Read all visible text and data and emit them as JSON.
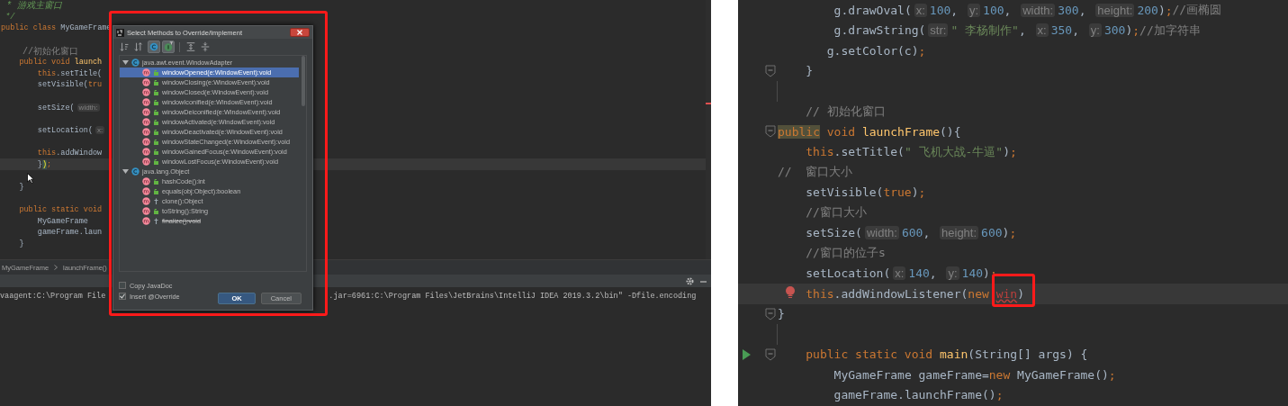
{
  "left_editor": {
    "lines": [
      {
        "tokens": [
          {
            "kind": "doc",
            "text": " * 游戏主窗口"
          }
        ]
      },
      {
        "tokens": [
          {
            "kind": "doc",
            "text": " */"
          }
        ]
      },
      {
        "tokens": [
          {
            "kind": "keyword",
            "text": "public class"
          },
          {
            "kind": "plain",
            "text": " MyGameFrame"
          }
        ]
      },
      {
        "kind": "blank"
      },
      {
        "tokens": [
          {
            "kind": "comment",
            "text": "    //初始化窗口"
          }
        ]
      },
      {
        "tokens": [
          {
            "kind": "keyword",
            "text": "    public void"
          },
          {
            "kind": "method",
            "text": " launch"
          }
        ]
      },
      {
        "tokens": [
          {
            "kind": "keyword",
            "text": "        this"
          },
          {
            "kind": "plain",
            "text": ".setTitle("
          }
        ]
      },
      {
        "tokens": [
          {
            "kind": "plain",
            "text": "        setVisible("
          },
          {
            "kind": "keyword",
            "text": "tru"
          }
        ]
      },
      {
        "kind": "blank"
      },
      {
        "tokens": [
          {
            "kind": "plain",
            "text": "        setSize("
          },
          {
            "kind": "hint",
            "text": "width:"
          }
        ]
      },
      {
        "kind": "blank"
      },
      {
        "tokens": [
          {
            "kind": "plain",
            "text": "        setLocation("
          },
          {
            "kind": "hint",
            "text": "x:"
          }
        ]
      },
      {
        "kind": "blank"
      },
      {
        "tokens": [
          {
            "kind": "keyword",
            "text": "        this"
          },
          {
            "kind": "plain",
            "text": ".addWindow"
          }
        ]
      },
      {
        "tokens": [
          {
            "kind": "plain",
            "text": "        }"
          },
          {
            "kind": "brace",
            "text": ")"
          },
          {
            "kind": "keyword",
            "text": ";"
          }
        ],
        "current": true
      },
      {
        "kind": "blank"
      },
      {
        "tokens": [
          {
            "kind": "plain",
            "text": "    }"
          }
        ]
      },
      {
        "kind": "blank"
      },
      {
        "tokens": [
          {
            "kind": "keyword",
            "text": "    public static void"
          }
        ]
      },
      {
        "tokens": [
          {
            "kind": "plain",
            "text": "        MyGameFrame"
          }
        ]
      },
      {
        "tokens": [
          {
            "kind": "plain",
            "text": "        gameFrame.laun"
          }
        ]
      },
      {
        "tokens": [
          {
            "kind": "plain",
            "text": "    }"
          }
        ]
      }
    ]
  },
  "breadcrumbs": [
    "MyGameFrame",
    "launchFrame()"
  ],
  "console": {
    "visible_parts": [
      "vaagent:C:\\Program File",
      ".jar=6961:C:\\Program Files\\JetBrains\\IntelliJ IDEA 2019.3.2\\bin\" -Dfile.encoding"
    ]
  },
  "dialog": {
    "title": "Select Methods to Override/Implement",
    "toolbar": [
      {
        "kind": "sort-visibility",
        "selected": false
      },
      {
        "kind": "sort-name",
        "selected": false
      },
      {
        "kind": "show-classes",
        "selected": true
      },
      {
        "kind": "show-interfaces",
        "selected": true
      },
      {
        "kind": "expand-all",
        "selected": false
      },
      {
        "kind": "collapse-all",
        "selected": false
      }
    ],
    "groups": [
      {
        "name": "java.awt.event.WindowAdapter",
        "expanded": true,
        "methods": [
          {
            "signature": "windowOpened(e:WindowEvent):void",
            "kind": "public",
            "deprecated": false,
            "selected": true
          },
          {
            "signature": "windowClosing(e:WindowEvent):void",
            "kind": "public",
            "deprecated": false,
            "selected": false
          },
          {
            "signature": "windowClosed(e:WindowEvent):void",
            "kind": "public",
            "deprecated": false,
            "selected": false
          },
          {
            "signature": "windowIconified(e:WindowEvent):void",
            "kind": "public",
            "deprecated": false,
            "selected": false
          },
          {
            "signature": "windowDeiconified(e:WindowEvent):void",
            "kind": "public",
            "deprecated": false,
            "selected": false
          },
          {
            "signature": "windowActivated(e:WindowEvent):void",
            "kind": "public",
            "deprecated": false,
            "selected": false
          },
          {
            "signature": "windowDeactivated(e:WindowEvent):void",
            "kind": "public",
            "deprecated": false,
            "selected": false
          },
          {
            "signature": "windowStateChanged(e:WindowEvent):void",
            "kind": "public",
            "deprecated": false,
            "selected": false
          },
          {
            "signature": "windowGainedFocus(e:WindowEvent):void",
            "kind": "public",
            "deprecated": false,
            "selected": false
          },
          {
            "signature": "windowLostFocus(e:WindowEvent):void",
            "kind": "public",
            "deprecated": false,
            "selected": false
          }
        ]
      },
      {
        "name": "java.lang.Object",
        "expanded": true,
        "methods": [
          {
            "signature": "hashCode():int",
            "kind": "public",
            "deprecated": false,
            "selected": false
          },
          {
            "signature": "equals(obj:Object):boolean",
            "kind": "public",
            "deprecated": false,
            "selected": false
          },
          {
            "signature": "clone():Object",
            "kind": "protected",
            "deprecated": false,
            "selected": false
          },
          {
            "signature": "toString():String",
            "kind": "public",
            "deprecated": false,
            "selected": false
          },
          {
            "signature": "finalize():void",
            "kind": "protected",
            "deprecated": true,
            "selected": false
          }
        ]
      }
    ],
    "options": [
      {
        "label": "Copy JavaDoc",
        "checked": false
      },
      {
        "label": "Insert @Override",
        "checked": true
      }
    ],
    "buttons": [
      {
        "label": "OK",
        "kind": "primary"
      },
      {
        "label": "Cancel",
        "kind": "secondary"
      }
    ]
  },
  "right_editor": {
    "lines": [
      {
        "tokens": [
          {
            "kind": "plain",
            "text": "        g.drawOval("
          },
          {
            "kind": "hint",
            "text": "x:"
          },
          {
            "kind": "number",
            "text": "100"
          },
          {
            "kind": "plain",
            "text": ", "
          },
          {
            "kind": "hint",
            "text": "y:"
          },
          {
            "kind": "number",
            "text": "100"
          },
          {
            "kind": "plain",
            "text": ", "
          },
          {
            "kind": "hint",
            "text": "width:"
          },
          {
            "kind": "number",
            "text": "300"
          },
          {
            "kind": "plain",
            "text": ", "
          },
          {
            "kind": "hint",
            "text": "height:"
          },
          {
            "kind": "number",
            "text": "200"
          },
          {
            "kind": "plain",
            "text": ")"
          },
          {
            "kind": "keyword",
            "text": ";"
          },
          {
            "kind": "comment",
            "text": "//画椭圆"
          }
        ],
        "fold": false,
        "run": false,
        "bulb": false
      },
      {
        "tokens": [
          {
            "kind": "plain",
            "text": "        g.drawString("
          },
          {
            "kind": "hint",
            "text": "str:"
          },
          {
            "kind": "string",
            "text": "\" 李杨制作\""
          },
          {
            "kind": "plain",
            "text": ", "
          },
          {
            "kind": "hint",
            "text": "x:"
          },
          {
            "kind": "number",
            "text": "350"
          },
          {
            "kind": "plain",
            "text": ", "
          },
          {
            "kind": "hint",
            "text": "y:"
          },
          {
            "kind": "number",
            "text": "300"
          },
          {
            "kind": "plain",
            "text": ")"
          },
          {
            "kind": "keyword",
            "text": ";"
          },
          {
            "kind": "comment",
            "text": "//加字符串"
          }
        ],
        "fold": false,
        "run": false,
        "bulb": false
      },
      {
        "tokens": [
          {
            "kind": "plain",
            "text": "       g.setColor(c)"
          },
          {
            "kind": "keyword",
            "text": ";"
          }
        ],
        "fold": false,
        "run": false,
        "bulb": false
      },
      {
        "tokens": [
          {
            "kind": "plain",
            "text": "    }"
          }
        ],
        "fold": true,
        "run": false,
        "bulb": false
      },
      {
        "kind": "blank",
        "fold": false,
        "run": false,
        "bulb": false
      },
      {
        "tokens": [
          {
            "kind": "comment",
            "text": "    // 初始化窗口"
          }
        ],
        "fold": false,
        "run": false,
        "bulb": false
      },
      {
        "tokens": [
          {
            "kind": "marked",
            "text": "public"
          },
          {
            "kind": "keyword",
            "text": " void"
          },
          {
            "kind": "method",
            "text": " launchFrame"
          },
          {
            "kind": "plain",
            "text": "(){"
          }
        ],
        "fold": true,
        "run": false,
        "bulb": false
      },
      {
        "tokens": [
          {
            "kind": "keyword",
            "text": "    this"
          },
          {
            "kind": "plain",
            "text": ".setTitle("
          },
          {
            "kind": "string",
            "text": "\" 飞机大战-牛逼\""
          },
          {
            "kind": "plain",
            "text": ")"
          },
          {
            "kind": "keyword",
            "text": ";"
          }
        ],
        "fold": false,
        "run": false,
        "bulb": false
      },
      {
        "tokens": [
          {
            "kind": "comment",
            "text": "//  窗口大小"
          }
        ],
        "fold": false,
        "run": false,
        "bulb": false
      },
      {
        "tokens": [
          {
            "kind": "plain",
            "text": "    setVisible("
          },
          {
            "kind": "keyword",
            "text": "true"
          },
          {
            "kind": "plain",
            "text": ")"
          },
          {
            "kind": "keyword",
            "text": ";"
          }
        ],
        "fold": false,
        "run": false,
        "bulb": false
      },
      {
        "tokens": [
          {
            "kind": "comment",
            "text": "    //窗口大小"
          }
        ],
        "fold": false,
        "run": false,
        "bulb": false
      },
      {
        "tokens": [
          {
            "kind": "plain",
            "text": "    setSize("
          },
          {
            "kind": "hint",
            "text": "width:"
          },
          {
            "kind": "number",
            "text": "600"
          },
          {
            "kind": "plain",
            "text": ", "
          },
          {
            "kind": "hint",
            "text": "height:"
          },
          {
            "kind": "number",
            "text": "600"
          },
          {
            "kind": "plain",
            "text": ")"
          },
          {
            "kind": "keyword",
            "text": ";"
          }
        ],
        "fold": false,
        "run": false,
        "bulb": false
      },
      {
        "tokens": [
          {
            "kind": "comment",
            "text": "    //窗口的位子s"
          }
        ],
        "fold": false,
        "run": false,
        "bulb": false
      },
      {
        "tokens": [
          {
            "kind": "plain",
            "text": "    setLocation("
          },
          {
            "kind": "hint",
            "text": "x:"
          },
          {
            "kind": "number",
            "text": "140"
          },
          {
            "kind": "plain",
            "text": ", "
          },
          {
            "kind": "hint",
            "text": "y:"
          },
          {
            "kind": "number",
            "text": "140"
          },
          {
            "kind": "plain",
            "text": ")"
          },
          {
            "kind": "keyword",
            "text": ";"
          }
        ],
        "fold": false,
        "run": false,
        "bulb": false
      },
      {
        "tokens": [
          {
            "kind": "keyword",
            "text": "    this"
          },
          {
            "kind": "plain",
            "text": ".addWindowListener("
          },
          {
            "kind": "keyword",
            "text": "new "
          },
          {
            "kind": "error",
            "text": "win"
          },
          {
            "kind": "plain",
            "text": ")"
          }
        ],
        "current": true,
        "fold": false,
        "run": false,
        "bulb": true
      },
      {
        "tokens": [
          {
            "kind": "plain",
            "text": "}"
          }
        ],
        "fold": true,
        "run": false,
        "bulb": false
      },
      {
        "kind": "blank",
        "fold": false,
        "run": false,
        "bulb": false
      },
      {
        "tokens": [
          {
            "kind": "keyword",
            "text": "    public static void"
          },
          {
            "kind": "method",
            "text": " main"
          },
          {
            "kind": "plain",
            "text": "(String[] args) {"
          }
        ],
        "fold": true,
        "run": true,
        "bulb": false
      },
      {
        "tokens": [
          {
            "kind": "plain",
            "text": "        MyGameFrame gameFrame="
          },
          {
            "kind": "keyword",
            "text": "new"
          },
          {
            "kind": "plain",
            "text": " MyGameFrame()"
          },
          {
            "kind": "keyword",
            "text": ";"
          }
        ],
        "fold": false,
        "run": false,
        "bulb": false
      },
      {
        "tokens": [
          {
            "kind": "plain",
            "text": "        gameFrame.launchFrame()"
          },
          {
            "kind": "keyword",
            "text": ";"
          }
        ],
        "fold": false,
        "run": false,
        "bulb": false
      }
    ]
  }
}
